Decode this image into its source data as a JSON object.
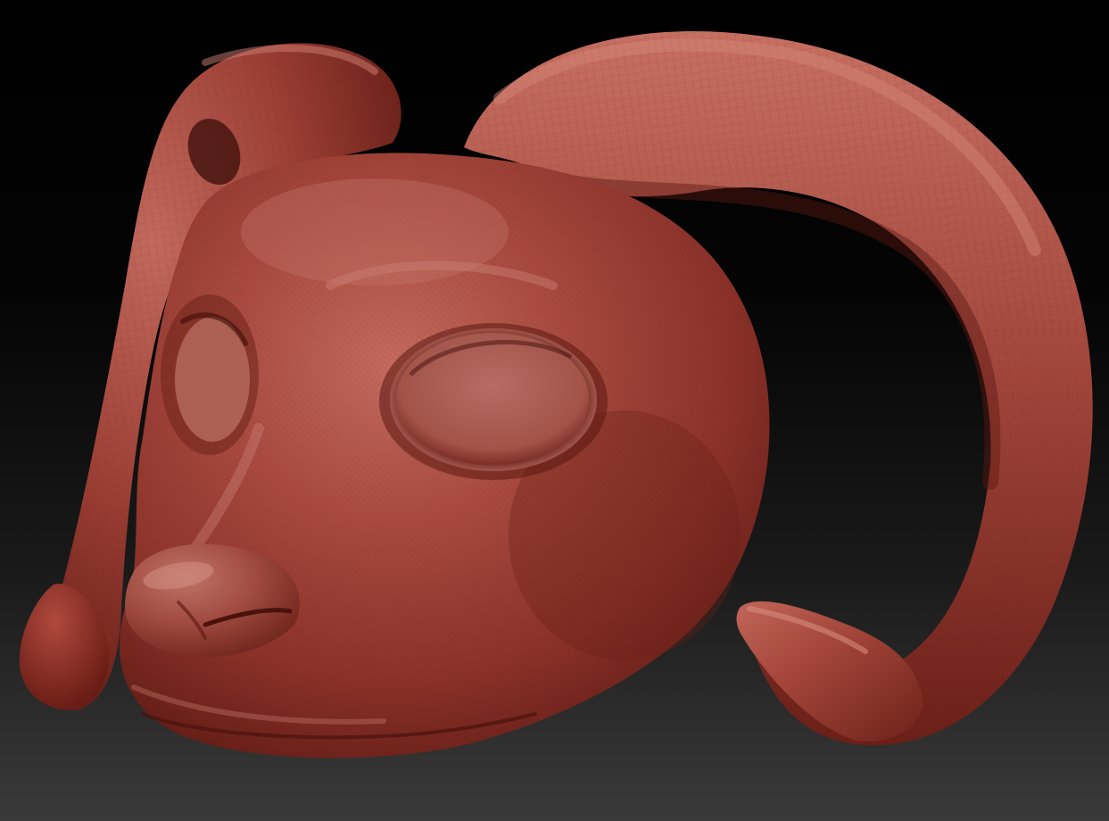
{
  "viewport": {
    "background_top": "#000000",
    "background_bottom": "#3a3a3a"
  },
  "model": {
    "subject": "ram-head-sculpt",
    "material_color": "#a5463c",
    "material_highlight": "#d98a7e",
    "material_shadow": "#4a120d",
    "wireframe_color": "#6b231c"
  }
}
